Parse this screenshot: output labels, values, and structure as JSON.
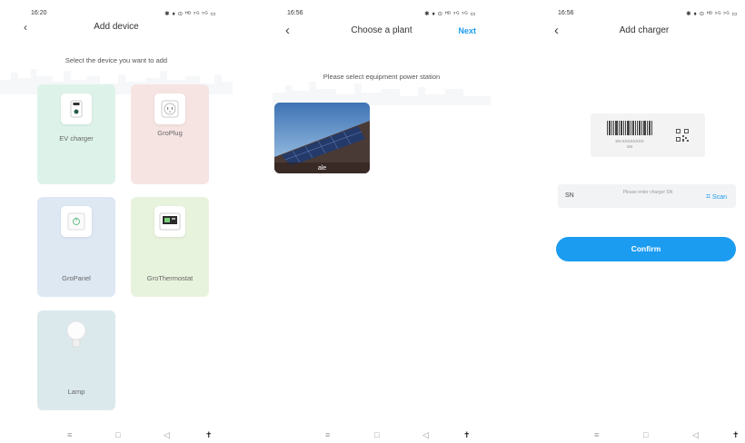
{
  "screen1": {
    "time": "16:20",
    "status_icons": "✱ ♦ ⊙ ᴴᴰ ⁵ᴳ ⁵ᴳ ▭",
    "title": "Add device",
    "subtitle": "Select the device you want to add",
    "cards": [
      {
        "label": "EV charger"
      },
      {
        "label": "GroPlug"
      },
      {
        "label": "GroPanel"
      },
      {
        "label": "GroThermostat"
      },
      {
        "label": "Lamp"
      }
    ]
  },
  "screen2": {
    "time": "16:56",
    "status_icons": "✱ ♦ ⊙ ᴴᴰ ⁵ᴳ ⁵ᴳ ▭",
    "title": "Choose a plant",
    "next": "Next",
    "prompt": "Please select equipment power station",
    "plant": {
      "label": "ale"
    }
  },
  "screen3": {
    "time": "16:56",
    "status_icons": "✱ ♦ ⊙ ᴴᴰ ⁵ᴳ ⁵ᴳ ▭",
    "title": "Add charger",
    "barcode_caption": "SN:XXXXXXXX",
    "barcode_caption2": "SN",
    "sn_label": "SN",
    "sn_placeholder": "Please enter charger SN",
    "scan": "Scan",
    "confirm": "Confirm"
  },
  "navbar": {
    "menu": "≡",
    "home": "□",
    "back": "◁",
    "accessibility": "✝"
  },
  "colors": {
    "accent": "#1c9cf0",
    "ev": "#ddf3ea",
    "plug": "#f6e4e3",
    "panel": "#dde8f3",
    "thermo": "#e8f3dd",
    "lamp": "#dbe9ec"
  }
}
